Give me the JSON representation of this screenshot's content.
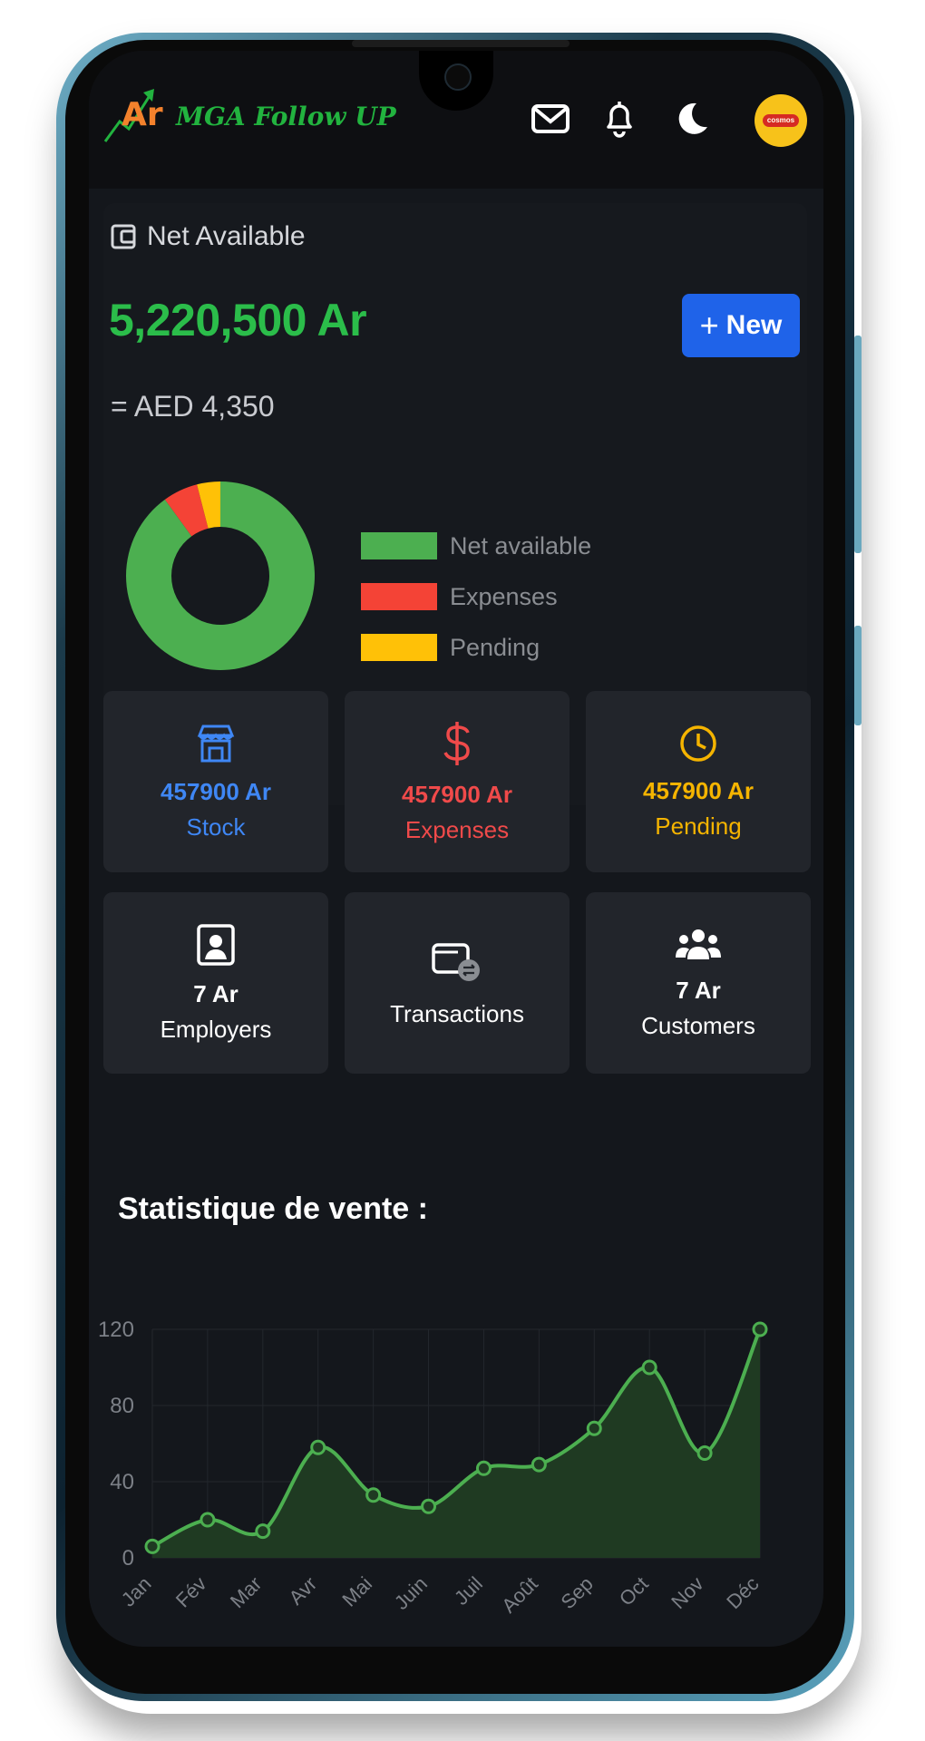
{
  "app": {
    "logo_mark": "Ar",
    "logo_text": "MGA Follow UP",
    "icons": [
      "mail-icon",
      "bell-icon",
      "moon-icon"
    ],
    "avatar_text": "cosmos"
  },
  "balance": {
    "label": "Net Available",
    "amount": "5,220,500 Ar",
    "new_button": "New",
    "converted": "= AED 4,350"
  },
  "donut": {
    "legend": [
      {
        "label": "Net available",
        "color": "#4caf50"
      },
      {
        "label": "Expenses",
        "color": "#f44336"
      },
      {
        "label": "Pending",
        "color": "#ffc107"
      }
    ],
    "values": [
      90,
      6,
      4
    ]
  },
  "tiles": [
    {
      "value": "457900 Ar",
      "label": "Stock",
      "color": "#3f87f5",
      "icon": "store-icon"
    },
    {
      "value": "457900 Ar",
      "label": "Expenses",
      "color": "#f04a4a",
      "icon": "dollar-icon"
    },
    {
      "value": "457900 Ar",
      "label": "Pending",
      "color": "#f5b400",
      "icon": "clock-icon"
    },
    {
      "value": "7 Ar",
      "label": "Employers",
      "color": "#ffffff",
      "icon": "employee-badge-icon"
    },
    {
      "value": "",
      "label": "Transactions",
      "color": "#ffffff",
      "icon": "wallet-transfer-icon"
    },
    {
      "value": "7 Ar",
      "label": "Customers",
      "color": "#ffffff",
      "icon": "users-icon"
    }
  ],
  "sales": {
    "title": "Statistique de vente :"
  },
  "chart_data": {
    "type": "area",
    "categories": [
      "Jan",
      "Fév",
      "Mar",
      "Avr",
      "Mai",
      "Juin",
      "Juil",
      "Août",
      "Sep",
      "Oct",
      "Nov",
      "Déc"
    ],
    "series": [
      {
        "values": [
          6,
          20,
          14,
          58,
          33,
          27,
          47,
          49,
          68,
          100,
          55,
          120
        ]
      }
    ],
    "yticks": [
      "0",
      "40",
      "80",
      "120"
    ],
    "ylim": [
      0,
      120
    ],
    "grid": true,
    "line_color": "#4caf50",
    "fill_color": "#1f3a22"
  }
}
